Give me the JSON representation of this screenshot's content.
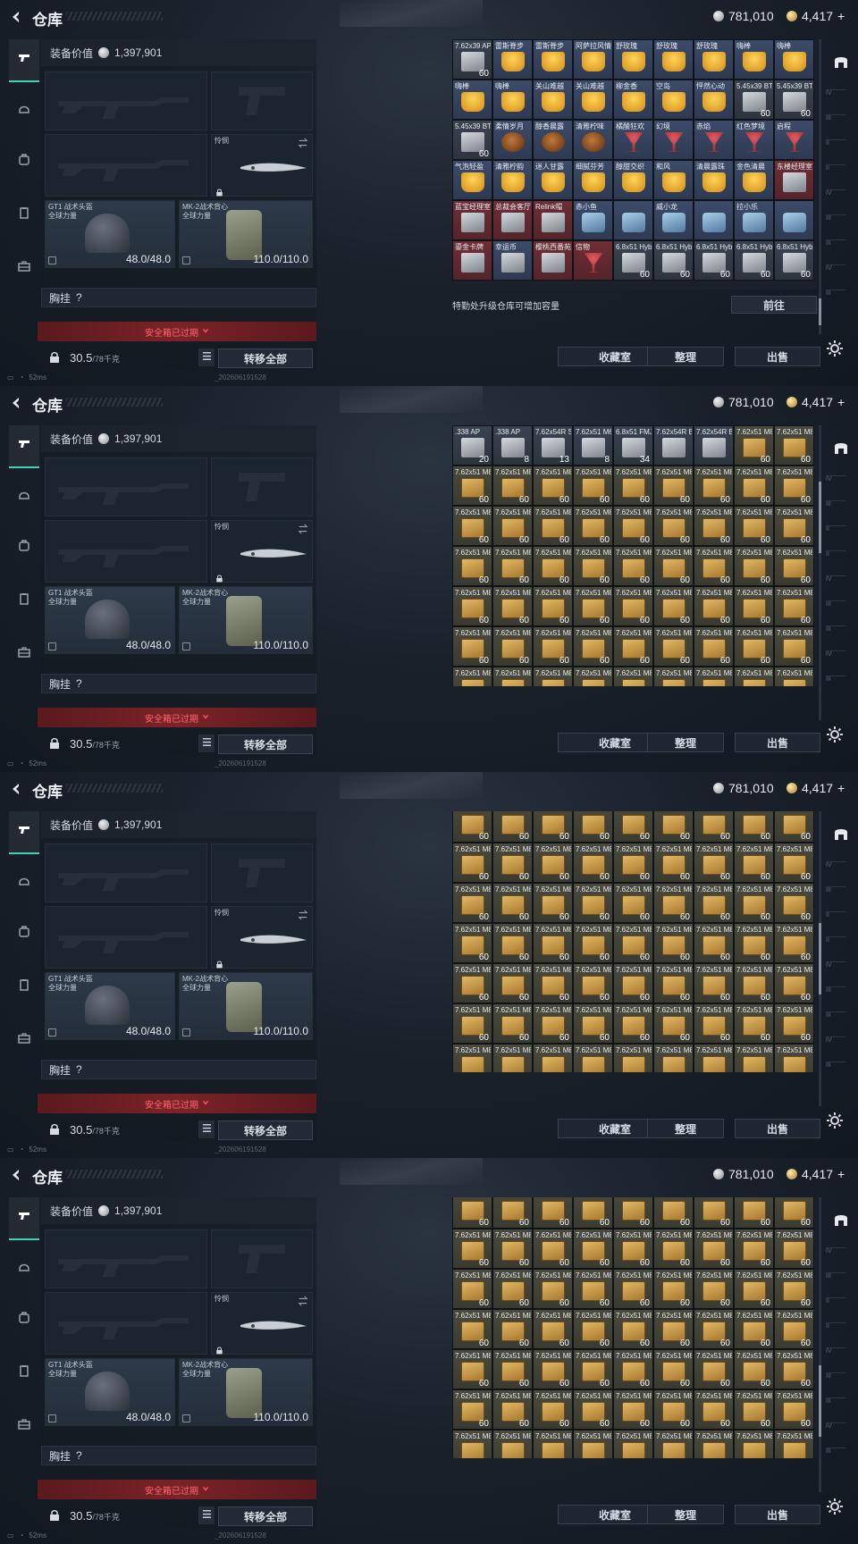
{
  "app": {
    "title": "仓库",
    "currency_silver": "781,010",
    "currency_gold": "4,417",
    "currency_plus": "+"
  },
  "loadout": {
    "value_label": "装备价值",
    "value": "1,397,901",
    "melee_label": "怜悯",
    "helmet_name": "GT1 战术头盔",
    "helmet_faction": "全球力量",
    "helmet_durability": "48.0/48.0",
    "vest_name": "MK-2战术背心",
    "vest_faction": "全球力量",
    "vest_durability": "110.0/110.0",
    "chest_rig_label": "胸挂",
    "chest_rig_value": "?",
    "safe_box_warning": "安全箱已过期",
    "weight": "30.5",
    "weight_max": "/78千克",
    "transfer_all_label": "转移全部"
  },
  "status": {
    "latency": "52ms",
    "build": "_202606191528"
  },
  "storage": {
    "upgrade_hint": "特勤处升级仓库可增加容量",
    "goto_label": "前往",
    "collection_label": "收藏室",
    "sort_label": "整理",
    "sell_label": "出售"
  },
  "panels": [
    {
      "scroll": 0.0,
      "rows": [
        [
          {
            "l": "7.62x39 AP",
            "c": "60",
            "k": "ammo"
          },
          {
            "l": "雷斯脊步",
            "c": "",
            "k": "drink"
          },
          {
            "l": "雷斯脊步",
            "c": "",
            "k": "drink"
          },
          {
            "l": "阿萨拉风情",
            "c": "",
            "k": "drink"
          },
          {
            "l": "舒玫瑰",
            "c": "",
            "k": "drink"
          },
          {
            "l": "舒玫瑰",
            "c": "",
            "k": "drink"
          },
          {
            "l": "舒玫瑰",
            "c": "",
            "k": "drink"
          },
          {
            "l": "嗨棒",
            "c": "",
            "k": "drink"
          },
          {
            "l": "嗨棒",
            "c": "",
            "k": "drink"
          }
        ],
        [
          {
            "l": "嗨棒",
            "c": "",
            "k": "drink"
          },
          {
            "l": "嗨棒",
            "c": "",
            "k": "drink"
          },
          {
            "l": "关山难越",
            "c": "",
            "k": "drink"
          },
          {
            "l": "关山难越",
            "c": "",
            "k": "drink"
          },
          {
            "l": "柳金香",
            "c": "",
            "k": "drink"
          },
          {
            "l": "空岛",
            "c": "",
            "k": "drink"
          },
          {
            "l": "怦然心动",
            "c": "",
            "k": "drink"
          },
          {
            "l": "5.45x39 BT",
            "c": "60",
            "k": "ammo"
          },
          {
            "l": "5.45x39 BT",
            "c": "60",
            "k": "ammo"
          }
        ],
        [
          {
            "l": "5.45x39 BT",
            "c": "60",
            "k": "ammo"
          },
          {
            "l": "柔情岁月",
            "c": "",
            "k": "dark"
          },
          {
            "l": "醇香晨露",
            "c": "",
            "k": "dark"
          },
          {
            "l": "清雅柠味",
            "c": "",
            "k": "dark"
          },
          {
            "l": "橘酸狂欢",
            "c": "",
            "k": "wine"
          },
          {
            "l": "幻境",
            "c": "",
            "k": "wine"
          },
          {
            "l": "赤焰",
            "c": "",
            "k": "wine"
          },
          {
            "l": "红色梦境",
            "c": "",
            "k": "wine"
          },
          {
            "l": "启程",
            "c": "",
            "k": "wine"
          }
        ],
        [
          {
            "l": "气泡轻盈",
            "c": "",
            "k": "glass"
          },
          {
            "l": "清雅柠韵",
            "c": "",
            "k": "glass"
          },
          {
            "l": "迷人甘露",
            "c": "",
            "k": "glass"
          },
          {
            "l": "细腻芬芳",
            "c": "",
            "k": "glass"
          },
          {
            "l": "醇甜交织",
            "c": "",
            "k": "glass"
          },
          {
            "l": "和风",
            "c": "",
            "k": "glass"
          },
          {
            "l": "清晨露珠",
            "c": "",
            "k": "glass"
          },
          {
            "l": "金色清晨",
            "c": "",
            "k": "glass"
          },
          {
            "l": "东楼经理室",
            "c": "",
            "k": "key"
          }
        ],
        [
          {
            "l": "蓝宝经理室",
            "c": "",
            "k": "key"
          },
          {
            "l": "总裁会客厅",
            "c": "",
            "k": "key"
          },
          {
            "l": "Relink帽",
            "c": "",
            "k": "key"
          },
          {
            "l": "赤小鱼",
            "c": "",
            "k": "misc"
          },
          {
            "l": "",
            "c": "",
            "k": "misc"
          },
          {
            "l": "威小龙",
            "c": "",
            "k": "misc"
          },
          {
            "l": "",
            "c": "",
            "k": "misc"
          },
          {
            "l": "拉小乐",
            "c": "",
            "k": "misc"
          },
          {
            "l": "",
            "c": "",
            "k": "misc"
          }
        ],
        [
          {
            "l": "鎏金卡牌",
            "c": "",
            "k": "key"
          },
          {
            "l": "幸运币",
            "c": "",
            "k": "coin"
          },
          {
            "l": "樱桃西番苑",
            "c": "",
            "k": "key"
          },
          {
            "l": "信物",
            "c": "",
            "k": "mask"
          },
          {
            "l": "6.8x51 Hybrid",
            "c": "60",
            "k": "ammo"
          },
          {
            "l": "6.8x51 Hybrid",
            "c": "60",
            "k": "ammo"
          },
          {
            "l": "6.8x51 Hybrid",
            "c": "60",
            "k": "ammo"
          },
          {
            "l": "6.8x51 Hybrid",
            "c": "60",
            "k": "ammo"
          },
          {
            "l": "6.8x51 Hybrid",
            "c": "60",
            "k": "ammo"
          }
        ]
      ]
    },
    {
      "scroll": 0.25,
      "rows": [
        [
          {
            "l": ".338 AP",
            "c": "20",
            "k": "ammo"
          },
          {
            "l": ".338 AP",
            "c": "8",
            "k": "ammo"
          },
          {
            "l": "7.62x54R SNB",
            "c": "13",
            "k": "ammo"
          },
          {
            "l": "7.62x51 M62",
            "c": "8",
            "k": "ammo"
          },
          {
            "l": "6.8x51 FMJ",
            "c": "34",
            "k": "ammo"
          },
          {
            "l": "7.62x54R BT",
            "c": "",
            "k": "ammo"
          },
          {
            "l": "7.62x54R BT",
            "c": "",
            "k": "ammo"
          },
          {
            "l": "7.62x51 M80",
            "c": "60",
            "k": "box"
          },
          {
            "l": "7.62x51 M80",
            "c": "60",
            "k": "box"
          }
        ]
      ]
    },
    {
      "scroll": 0.5,
      "rows": []
    },
    {
      "scroll": 0.75,
      "rows": []
    }
  ],
  "repeat_cell": {
    "l": "7.62x51 M80",
    "c": "60",
    "k": "box"
  },
  "right_rail_tags": [
    "IV",
    "III",
    "II",
    "II",
    "IV",
    "III",
    "III",
    "IV",
    "III"
  ]
}
